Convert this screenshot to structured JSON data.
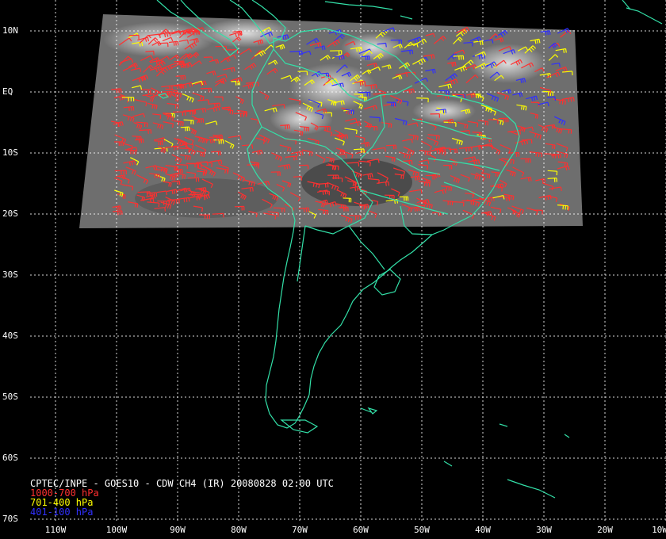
{
  "title": "CPTEC/INPE - GOES10 - CDW CH4 (IR) 20080828 02:00 UTC",
  "legend": [
    {
      "label": "1000-700 hPa",
      "color": "#ff3030"
    },
    {
      "label": "701-400 hPa",
      "color": "#ffff00"
    },
    {
      "label": "401-100 hPa",
      "color": "#3030ff"
    }
  ],
  "colors": {
    "coastline": "#33e0a8",
    "grid": "#ffffff",
    "background": "#000000",
    "imagery": "#6e6e6e"
  },
  "lat_labels": [
    "10N",
    "EQ",
    "10S",
    "20S",
    "30S",
    "40S",
    "50S",
    "60S",
    "70S"
  ],
  "lon_labels": [
    "110W",
    "100W",
    "90W",
    "80W",
    "70W",
    "60W",
    "50W",
    "40W",
    "30W",
    "20W",
    "10W"
  ]
}
